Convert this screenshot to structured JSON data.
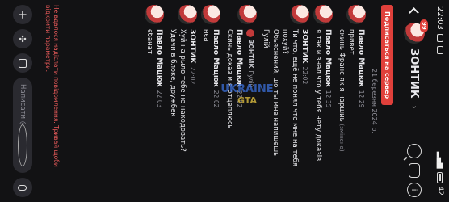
{
  "status_bar": {
    "time": "22:03",
    "battery": "42"
  },
  "header": {
    "title": "ЗОНТИК",
    "badge": "99"
  },
  "banner": {
    "subscribe_label": "Подписаться на сервер"
  },
  "date_separator": "21 березня 2024 р.",
  "messages": [
    {
      "author": "Павло Мацюк",
      "time": "12:29",
      "lines": [
        "привет",
        "скинь Франс як я наршиь"
      ],
      "edited": "(змінено)"
    },
    {
      "author": "Павло Мацюк",
      "time": "12:35",
      "lines": [
        "я так и знал что у тебя нету доказів"
      ]
    },
    {
      "author": "ЗОНТИК",
      "time": "22:02",
      "lines": [
        "Ти что, ещё не понял что мне на тебя",
        "похуй?",
        "Обьяснений, шо ты мне напишешь",
        "Гулій"
      ]
    },
    {
      "reply_to": "ЗОНТИК",
      "reply_text": "Гулій",
      "author": "Павло Мацюк",
      "time": "22:02",
      "lines": [
        "Скинь доказ и я отцеплюсь"
      ]
    },
    {
      "author": "Павло Мацюк",
      "time": "22:02",
      "lines": [
        "нєа"
      ]
    },
    {
      "author": "ЗОНТИК",
      "time": "22:02",
      "lines": [
        "Хуй на рыло тебе не накодовать?",
        "Удачи в блоке, дружбек"
      ]
    },
    {
      "author": "Павло Мацюк",
      "time": "22:03",
      "lines": [
        "єбанат"
      ]
    }
  ],
  "error": "Не вдалося надіслати повідомлення. Тривай щоби відкрити параметри.",
  "composer": {
    "placeholder": "Написати @з..."
  },
  "watermark": {
    "line1": "UKRAINE",
    "line2": "GTA"
  }
}
